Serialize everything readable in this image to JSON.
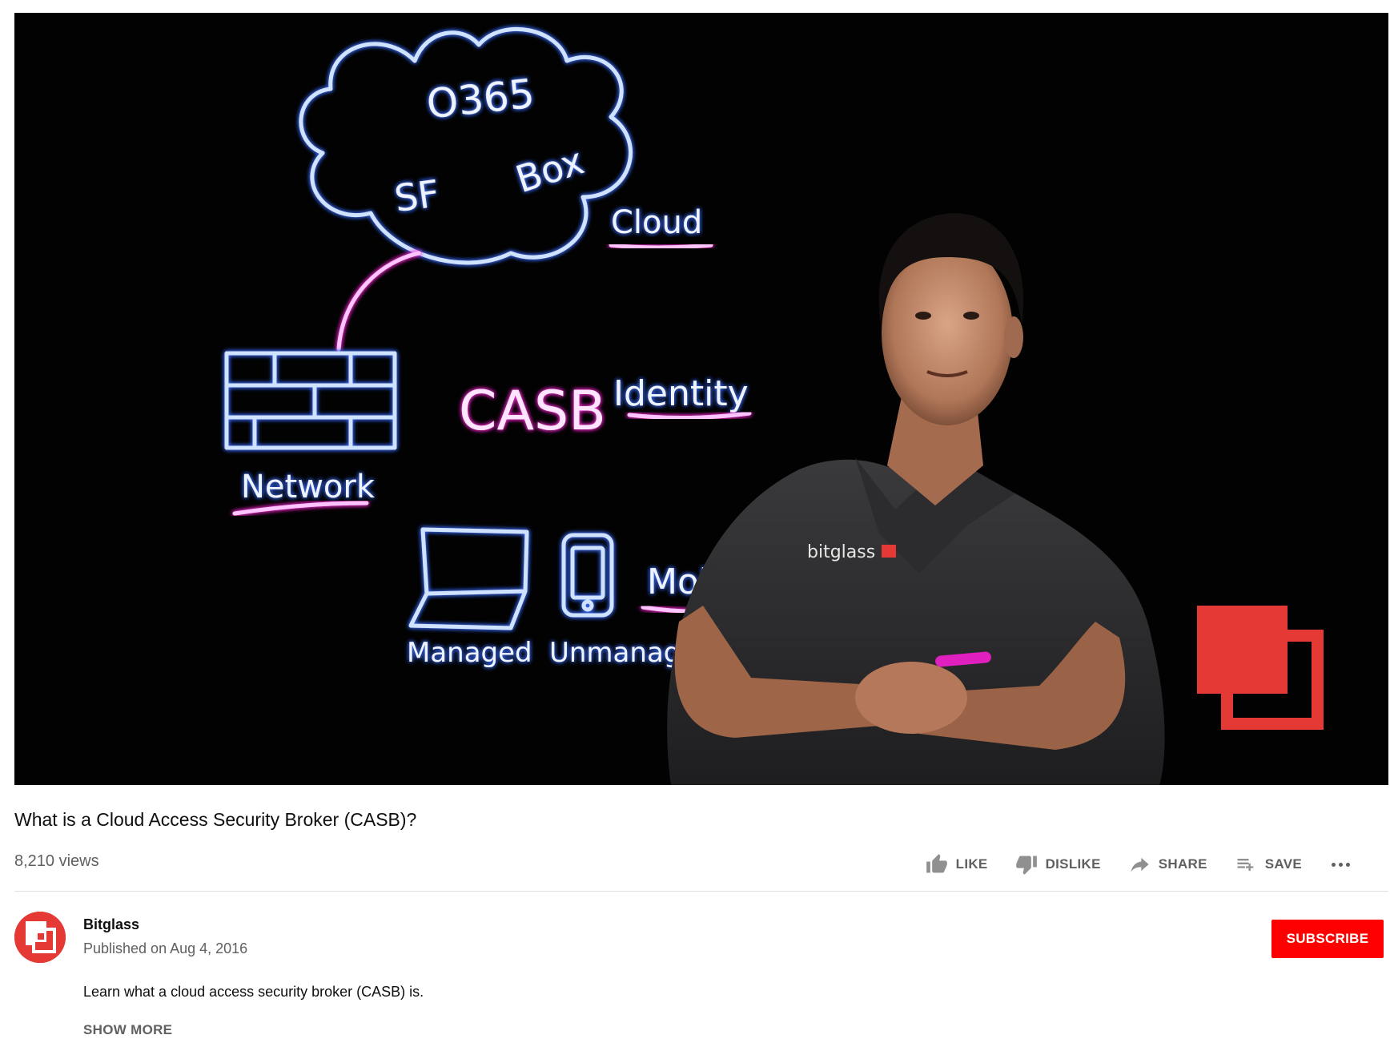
{
  "video": {
    "frame_text": {
      "cloud_line1": "O365",
      "cloud_sf": "SF",
      "cloud_box": "Box",
      "cloud_label": "Cloud",
      "casb": "CASB",
      "identity": "Identity",
      "network": "Network",
      "mobile": "Mobile",
      "managed": "Managed",
      "unmanaged": "Unmanaged",
      "shirt_logo": "bitglass"
    },
    "colors": {
      "background": "#020202",
      "neon_blue": "#cfe2ff",
      "neon_pink": "#ffc3ff",
      "brand_red": "#e53935"
    }
  },
  "title": "What is a Cloud Access Security Broker (CASB)?",
  "views": "8,210 views",
  "actions": {
    "like": "LIKE",
    "dislike": "DISLIKE",
    "share": "SHARE",
    "save": "SAVE"
  },
  "channel": {
    "name": "Bitglass",
    "published": "Published on Aug 4, 2016",
    "subscribe": "SUBSCRIBE",
    "avatar_icon": "bitglass-logo-icon"
  },
  "description": {
    "text": "Learn what a cloud access security broker (CASB) is.",
    "show_more": "SHOW MORE"
  },
  "icons": {
    "like": "thumbs-up-icon",
    "dislike": "thumbs-down-icon",
    "share": "share-arrow-icon",
    "save": "playlist-add-icon",
    "more": "more-horizontal-icon"
  },
  "colors": {
    "subscribe_bg": "#ff0000",
    "secondary_text": "#606060",
    "divider": "#e0e0e0"
  }
}
